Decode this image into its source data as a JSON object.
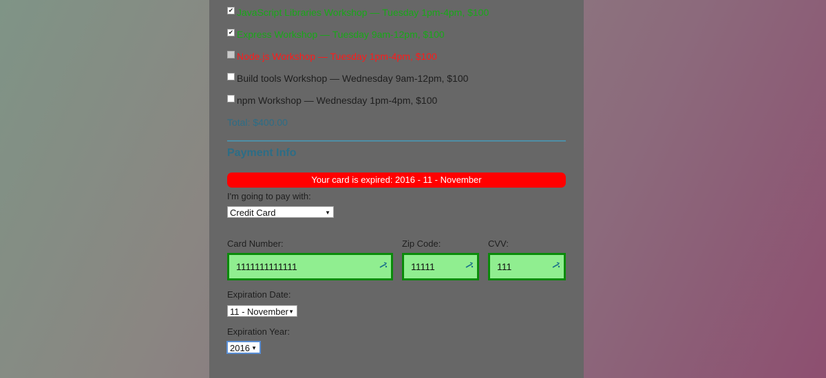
{
  "activities": [
    {
      "label": "JavaScript Libraries Workshop — Tuesday 1pm-4pm, $100",
      "checked": true,
      "state": "selected"
    },
    {
      "label": "Express Workshop — Tuesday 9am-12pm, $100",
      "checked": true,
      "state": "selected"
    },
    {
      "label": "Node.js Workshop — Tuesday 1pm-4pm, $100",
      "checked": false,
      "state": "conflict"
    },
    {
      "label": "Build tools Workshop — Wednesday 9am-12pm, $100",
      "checked": false,
      "state": "available"
    },
    {
      "label": "npm Workshop — Wednesday 1pm-4pm, $100",
      "checked": false,
      "state": "available"
    }
  ],
  "total": "Total: $400.00",
  "payment": {
    "title": "Payment Info",
    "error": "Your card is expired: 2016 - 11 - November",
    "method_label": "I'm going to pay with:",
    "method_value": "Credit Card",
    "card_label": "Card Number:",
    "card_value": "1111111111111",
    "zip_label": "Zip Code:",
    "zip_value": "11111",
    "cvv_label": "CVV:",
    "cvv_value": "111",
    "exp_date_label": "Expiration Date:",
    "exp_date_value": "11 - November",
    "exp_year_label": "Expiration Year:",
    "exp_year_value": "2016"
  },
  "colors": {
    "selected_text": "#18a818",
    "conflict_text": "#ff1a1a",
    "section_accent": "#2c6d86",
    "error_banner": "#ff0000",
    "valid_field_bg": "#90ee90",
    "valid_field_border": "#0a8a0a"
  },
  "icons": {
    "field_icon": "key-icon"
  }
}
